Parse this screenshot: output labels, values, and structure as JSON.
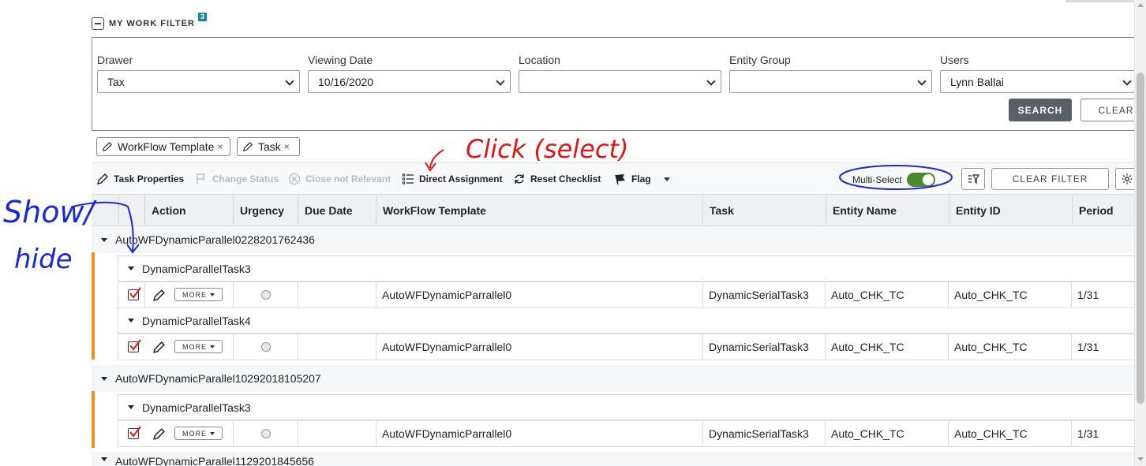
{
  "filter": {
    "title": "MY WORK FILTER",
    "badge": "3",
    "fields": [
      {
        "label": "Drawer",
        "value": "Tax"
      },
      {
        "label": "Viewing Date",
        "value": "10/16/2020"
      },
      {
        "label": "Location",
        "value": ""
      },
      {
        "label": "Entity Group",
        "value": ""
      },
      {
        "label": "Users",
        "value": "Lynn Ballai"
      }
    ],
    "search_label": "SEARCH",
    "clear_label": "CLEAR"
  },
  "chips": [
    {
      "label": "WorkFlow Template",
      "remove": "×"
    },
    {
      "label": "Task",
      "remove": "×"
    }
  ],
  "toolbar": {
    "task_properties": "Task Properties",
    "change_status": "Change Status",
    "close_not_relevant": "Close not Relevant",
    "direct_assignment": "Direct Assignment",
    "reset_checklist": "Reset Checklist",
    "flag": "Flag",
    "multi_select": "Multi-Select",
    "multi_select_on": true,
    "clear_filter": "CLEAR FILTER"
  },
  "table": {
    "columns": [
      "Action",
      "Urgency",
      "Due Date",
      "WorkFlow Template",
      "Task",
      "Entity Name",
      "Entity ID",
      "Period"
    ],
    "more_label": "MORE",
    "groups": [
      {
        "name": "AutoWFDynamicParallel0228201762436",
        "subgroups": [
          {
            "name": "DynamicParallelTask3",
            "row": {
              "template": "AutoWFDynamicParrallel0",
              "task": "DynamicSerialTask3",
              "entity_name": "Auto_CHK_TC",
              "entity_id": "Auto_CHK_TC",
              "period": "1/31"
            }
          },
          {
            "name": "DynamicParallelTask4",
            "row": {
              "template": "AutoWFDynamicParrallel0",
              "task": "DynamicSerialTask3",
              "entity_name": "Auto_CHK_TC",
              "entity_id": "Auto_CHK_TC",
              "period": "1/31"
            }
          }
        ]
      },
      {
        "name": "AutoWFDynamicParallel10292018105207",
        "subgroups": [
          {
            "name": "DynamicParallelTask3",
            "row": {
              "template": "AutoWFDynamicParrallel0",
              "task": "DynamicSerialTask3",
              "entity_name": "Auto_CHK_TC",
              "entity_id": "Auto_CHK_TC",
              "period": "1/31"
            }
          }
        ]
      },
      {
        "name": "AutoWFDynamicParallel1129201845656",
        "subgroups": []
      }
    ]
  },
  "annotations": {
    "blue_text_1": "Show/",
    "blue_text_2": "hide",
    "red_text": "Click (select)"
  },
  "colors": {
    "accent_bar": "#f28c1f",
    "toggle_on": "#4a8a2e",
    "badge": "#138a9e",
    "search_button": "#5a5f66",
    "annotation_blue": "#1a2ad6",
    "annotation_red": "#e01616"
  }
}
